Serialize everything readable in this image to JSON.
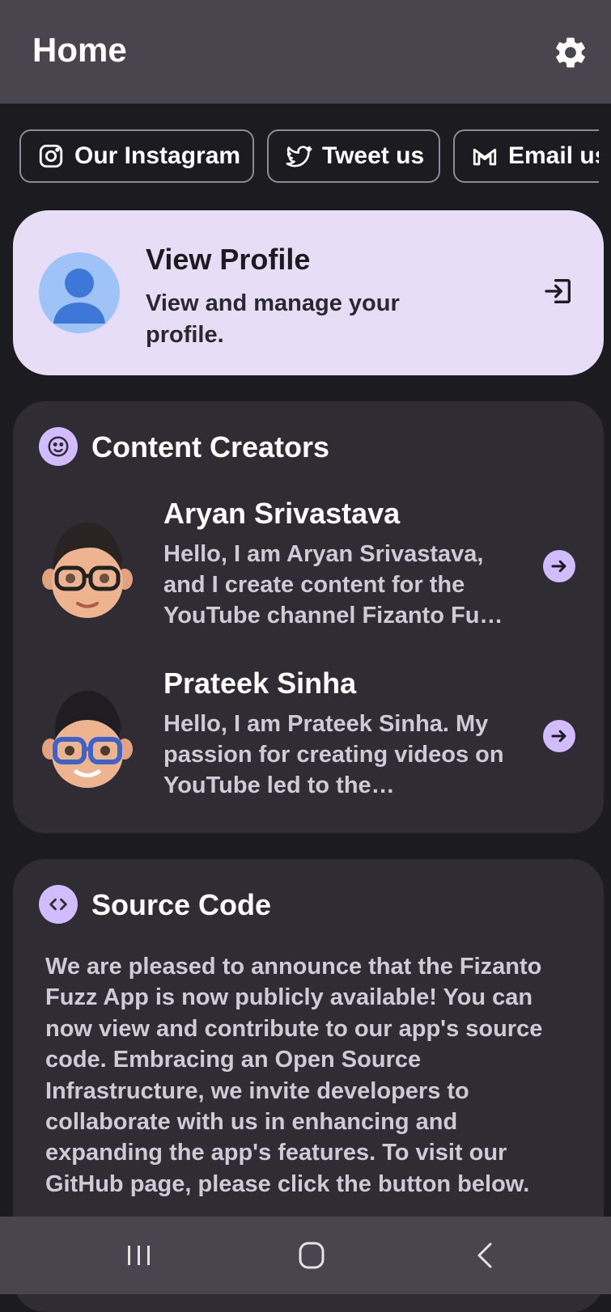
{
  "header": {
    "title": "Home",
    "settings_icon": "gear-icon"
  },
  "chips": [
    {
      "label": "Our Instagram",
      "icon": "instagram-icon"
    },
    {
      "label": "Tweet us",
      "icon": "twitter-icon"
    },
    {
      "label": "Email us",
      "icon": "gmail-icon"
    }
  ],
  "profile": {
    "title": "View Profile",
    "subtitle": "View and manage your profile.",
    "action_icon": "exit-arrow-icon"
  },
  "creators": {
    "title": "Content Creators",
    "icon": "smiley-icon",
    "items": [
      {
        "name": "Aryan Srivastava",
        "description": "Hello, I am Aryan Srivastava, and I create content for the YouTube channel Fizanto Fu…",
        "avatar": "memoji-avatar"
      },
      {
        "name": "Prateek Sinha",
        "description": "Hello, I am Prateek Sinha. My passion for creating videos on YouTube led to the…",
        "avatar": "memoji-avatar"
      }
    ]
  },
  "source_code": {
    "title": "Source Code",
    "icon": "code-icon",
    "body": "We are pleased to announce that the Fizanto Fuzz App is now publicly available! You can now view and contribute to our app's source code. Embracing an Open Source Infrastructure, we invite developers to collaborate with us in enhancing and expanding the app's features. To visit our GitHub page, please click the button below."
  },
  "colors": {
    "background": "#1c1b1f",
    "app_bar": "#49454f",
    "profile_card": "#e8ddf7",
    "card": "#2f2c34",
    "accent": "#d0bcff"
  }
}
